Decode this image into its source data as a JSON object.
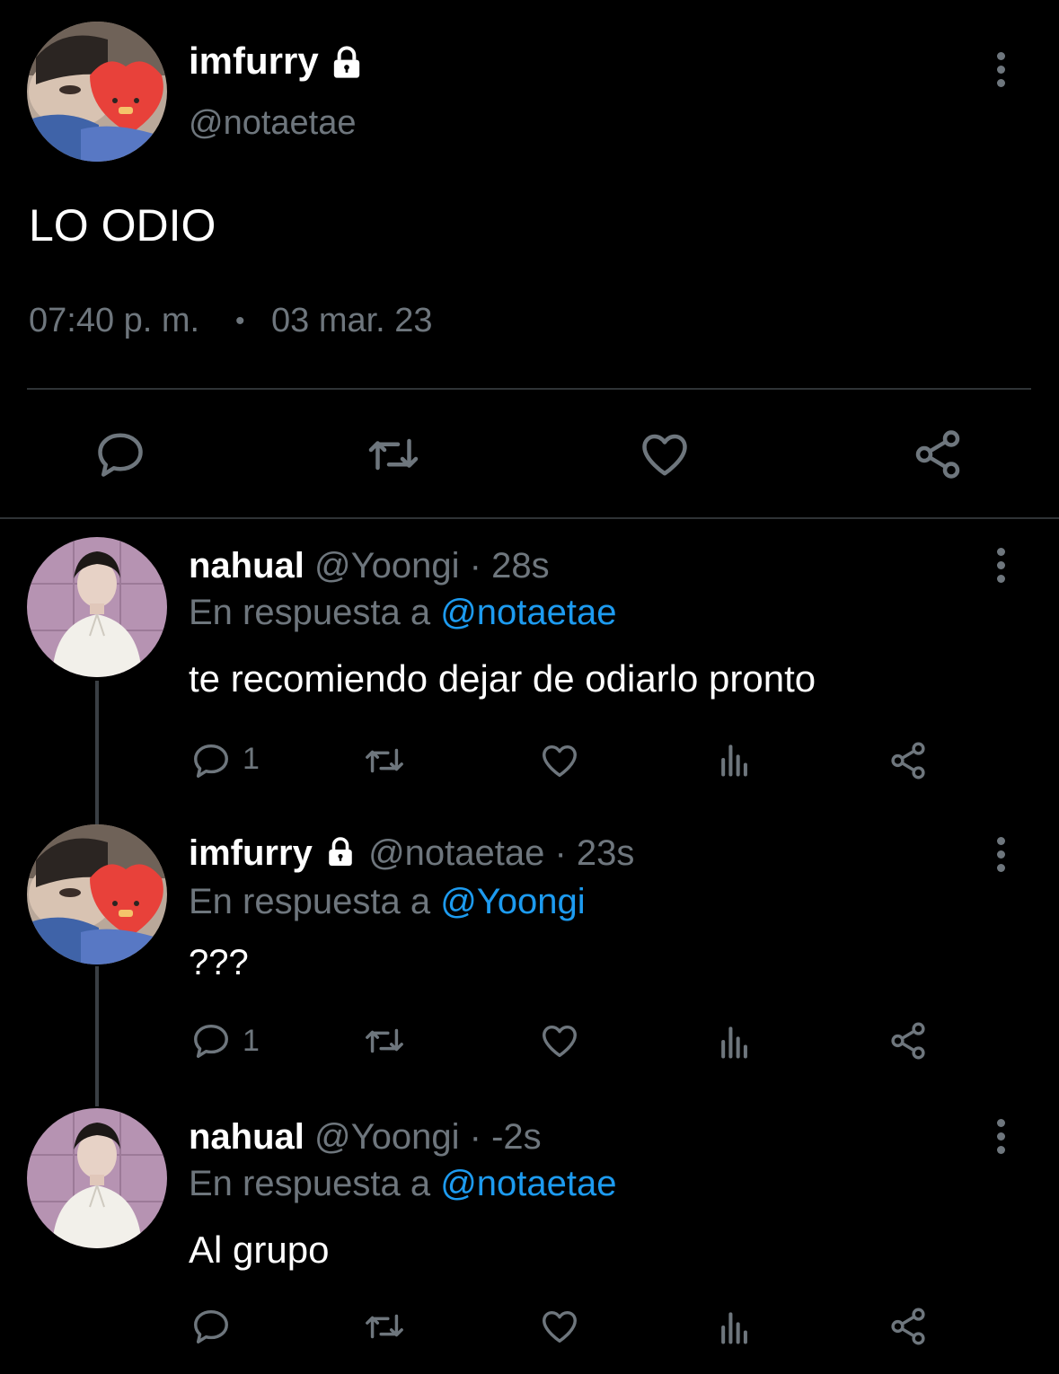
{
  "main_tweet": {
    "display_name": "imfurry",
    "handle": "@notaetae",
    "text": "LO ODIO",
    "time": "07:40 p. m.",
    "separator": "•",
    "date": "03 mar. 23",
    "locked_icon": "lock-icon",
    "actions": [
      "reply-icon",
      "retweet-icon",
      "like-icon",
      "share-icon"
    ]
  },
  "replies": [
    {
      "display_name": "nahual",
      "handle": "@Yoongi",
      "time": "· 28s",
      "reply_prefix": "En respuesta a",
      "reply_to": "@notaetae",
      "text": "te recomiendo dejar de odiarlo pronto",
      "reply_count": "1"
    },
    {
      "display_name": "imfurry",
      "handle": "@notaetae",
      "time": "· 23s",
      "reply_prefix": "En respuesta a",
      "reply_to": "@Yoongi",
      "text": "???",
      "reply_count": "1"
    },
    {
      "display_name": "nahual",
      "handle": "@Yoongi",
      "time": "· -2s",
      "reply_prefix": "En respuesta a",
      "reply_to": "@notaetae",
      "text": "Al grupo",
      "reply_count": ""
    }
  ],
  "colors": {
    "background": "#000000",
    "muted": "#6e767d",
    "link": "#1d9bf0"
  }
}
